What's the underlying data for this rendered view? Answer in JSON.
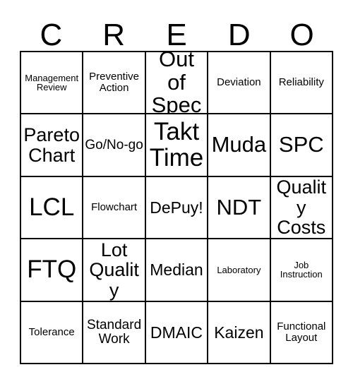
{
  "card": {
    "title_letters": [
      "C",
      "R",
      "E",
      "D",
      "O"
    ],
    "columns": 5,
    "rows": 5,
    "border_color": "#000000",
    "background_color": "#ffffff",
    "text_color": "#000000"
  },
  "cells": [
    {
      "text": "Management Review",
      "size": "s-xs"
    },
    {
      "text": "Preventive Action",
      "size": "s-sm"
    },
    {
      "text": "Out of Spec",
      "size": "s-xxl"
    },
    {
      "text": "Deviation",
      "size": "s-sm"
    },
    {
      "text": "Reliability",
      "size": "s-sm"
    },
    {
      "text": "Pareto Chart",
      "size": "s-xl"
    },
    {
      "text": "Go/No-go",
      "size": "s-md"
    },
    {
      "text": "Takt Time",
      "size": "s-hg"
    },
    {
      "text": "Muda",
      "size": "s-xxl"
    },
    {
      "text": "SPC",
      "size": "s-xxl"
    },
    {
      "text": "LCL",
      "size": "s-hg"
    },
    {
      "text": "Flowchart",
      "size": "s-sm"
    },
    {
      "text": "DePuy!",
      "size": "s-lg"
    },
    {
      "text": "NDT",
      "size": "s-xxl"
    },
    {
      "text": "Quality Costs",
      "size": "s-xl"
    },
    {
      "text": "FTQ",
      "size": "s-hg"
    },
    {
      "text": "Lot Quality",
      "size": "s-xl"
    },
    {
      "text": "Median",
      "size": "s-lg"
    },
    {
      "text": "Laboratory",
      "size": "s-xs"
    },
    {
      "text": "Job Instruction",
      "size": "s-xs"
    },
    {
      "text": "Tolerance",
      "size": "s-sm"
    },
    {
      "text": "Standard Work",
      "size": "s-md"
    },
    {
      "text": "DMAIC",
      "size": "s-lg"
    },
    {
      "text": "Kaizen",
      "size": "s-lg"
    },
    {
      "text": "Functional Layout",
      "size": "s-sm"
    }
  ]
}
